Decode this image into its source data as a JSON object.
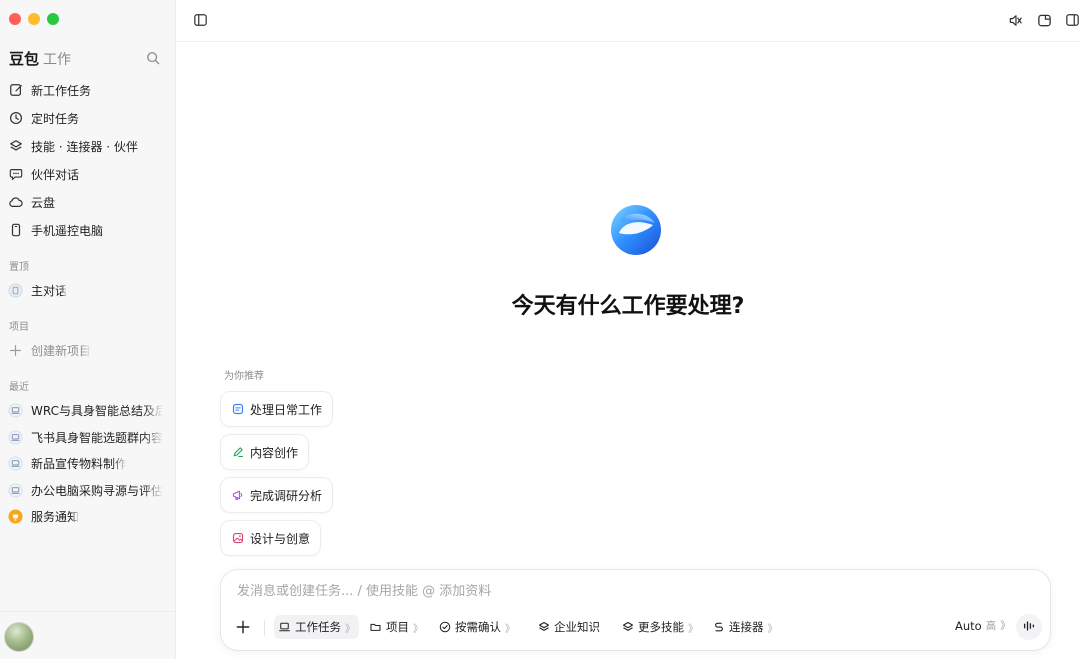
{
  "sidebar": {
    "brand": {
      "name": "豆包",
      "sub": "工作"
    },
    "nav": [
      {
        "label": "新工作任务",
        "icon": "edit-icon"
      },
      {
        "label": "定时任务",
        "icon": "clock-icon"
      },
      {
        "label": "技能 · 连接器 · 伙伴",
        "icon": "layers-icon"
      },
      {
        "label": "伙伴对话",
        "icon": "chat-icon"
      },
      {
        "label": "云盘",
        "icon": "cloud-icon"
      },
      {
        "label": "手机遥控电脑",
        "icon": "phone-icon"
      }
    ],
    "pinned_label": "置顶",
    "pinned": [
      {
        "label": "主对话",
        "icon": "main-chat-icon"
      }
    ],
    "projects_label": "项目",
    "new_project": {
      "label": "创建新项目",
      "icon": "plus-icon"
    },
    "recent_label": "最近",
    "recent": [
      {
        "label": "WRC与具身智能总结及后",
        "icon": "laptop-icon"
      },
      {
        "label": "飞书具身智能选题群内容",
        "icon": "laptop-icon"
      },
      {
        "label": "新品宣传物料制作",
        "icon": "laptop-icon"
      },
      {
        "label": "办公电脑采购寻源与评估",
        "icon": "laptop-icon"
      },
      {
        "label": "服务通知",
        "icon": "notification-icon"
      }
    ]
  },
  "topbar": {
    "icons": [
      "sidebar-toggle-icon",
      "mute-icon",
      "new-window-icon",
      "panel-icon"
    ]
  },
  "main": {
    "headline": "今天有什么工作要处理?",
    "recommend_label": "为你推荐",
    "suggestions": [
      {
        "label": "处理日常工作",
        "icon": "document-icon",
        "color": "#3b82f6"
      },
      {
        "label": "内容创作",
        "icon": "pen-icon",
        "color": "#22a35a"
      },
      {
        "label": "完成调研分析",
        "icon": "megaphone-icon",
        "color": "#a855f7"
      },
      {
        "label": "设计与创意",
        "icon": "image-icon",
        "color": "#e0436b"
      }
    ]
  },
  "composer": {
    "placeholder": "发消息或创建任务... / 使用技能 @ 添加资料",
    "tools": [
      {
        "label": "工作任务",
        "chevron": "》",
        "icon": "laptop-icon",
        "active": true
      },
      {
        "label": "项目",
        "chevron": "》",
        "icon": "folder-icon",
        "active": false
      },
      {
        "label": "按需确认",
        "chevron": "》",
        "icon": "check-circle-icon",
        "active": false
      },
      {
        "label": "企业知识",
        "chevron": "",
        "icon": "layers-icon",
        "active": false
      },
      {
        "label": "更多技能",
        "chevron": "》",
        "icon": "layers-icon",
        "active": false
      },
      {
        "label": "连接器",
        "chevron": "》",
        "icon": "connector-icon",
        "active": false
      }
    ],
    "model": {
      "label": "Auto",
      "sub": "高",
      "chevron": "》"
    }
  },
  "colors": {
    "accent": "#2f6bff",
    "sidebar_bg": "#f7f7f8"
  }
}
